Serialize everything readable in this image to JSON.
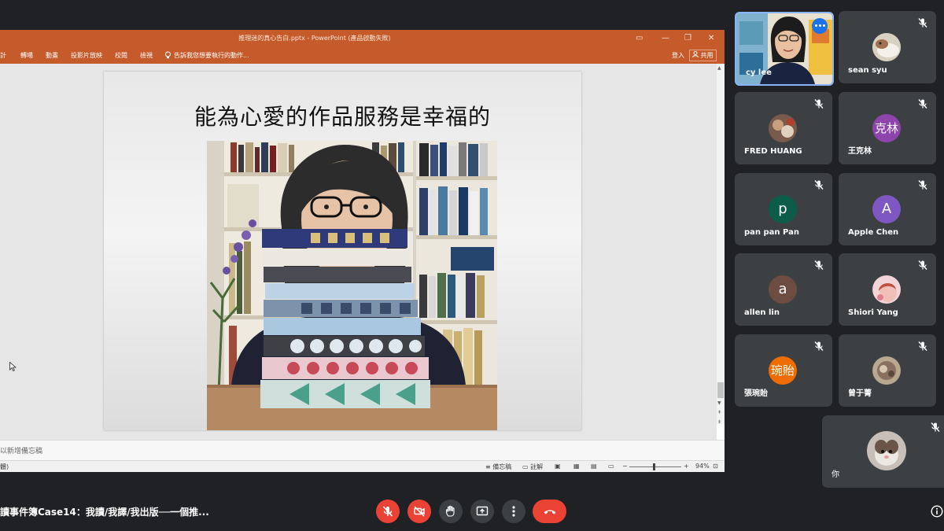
{
  "powerpoint": {
    "window_title": "推理迷的真心告白.pptx - PowerPoint (產品啟動失敗)",
    "ribbon_tabs": [
      "計",
      "轉場",
      "動畫",
      "投影片放映",
      "校閱",
      "檢視"
    ],
    "tell_me": "告訴我您想要執行的動作...",
    "sign_in": "登入",
    "share": "共用",
    "notes_placeholder": "以新增備忘稿",
    "status_left": "體)",
    "notes_button": "備忘稿",
    "comments_button": "註解",
    "zoom_minus": "−",
    "zoom_plus": "+",
    "zoom_percent": "94%"
  },
  "slide": {
    "title": "能為心愛的作品服務是幸福的"
  },
  "participants": [
    {
      "name": "cy lee",
      "avatar_type": "video"
    },
    {
      "name": "sean syu",
      "avatar_type": "photo"
    },
    {
      "name": "FRED HUANG",
      "avatar_type": "photo"
    },
    {
      "name": "王克林",
      "avatar_type": "initials",
      "initials": "克林",
      "color": "#8e44ad"
    },
    {
      "name": "pan pan Pan",
      "avatar_type": "initials",
      "initials": "p",
      "color": "#0b5d49"
    },
    {
      "name": "Apple Chen",
      "avatar_type": "initials",
      "initials": "A",
      "color": "#7e57c2"
    },
    {
      "name": "allen lin",
      "avatar_type": "initials",
      "initials": "a",
      "color": "#6d4c41"
    },
    {
      "name": "Shiori Yang",
      "avatar_type": "photo"
    },
    {
      "name": "張琬貽",
      "avatar_type": "initials",
      "initials": "琬貽",
      "color": "#ef6c00"
    },
    {
      "name": "曾于菁",
      "avatar_type": "photo"
    }
  ],
  "self_tile": {
    "name": "你",
    "avatar_type": "photo"
  },
  "meeting_title": "讀事件簿Case14：我讀/我譯/我出版──一個推...",
  "controls": [
    {
      "name": "mic-off",
      "color": "#ea4335"
    },
    {
      "name": "camera-off",
      "color": "#ea4335"
    },
    {
      "name": "raise-hand",
      "color": "#3c4043"
    },
    {
      "name": "present-screen",
      "color": "#3c4043"
    },
    {
      "name": "more-options",
      "color": "#3c4043"
    },
    {
      "name": "leave-call",
      "color": "#ea4335"
    }
  ],
  "icons": [
    "mic-off-icon",
    "camera-off-icon",
    "hand-icon",
    "present-icon",
    "more-icon",
    "hang-up-icon",
    "info-icon",
    "lightbulb-icon",
    "person-icon"
  ]
}
